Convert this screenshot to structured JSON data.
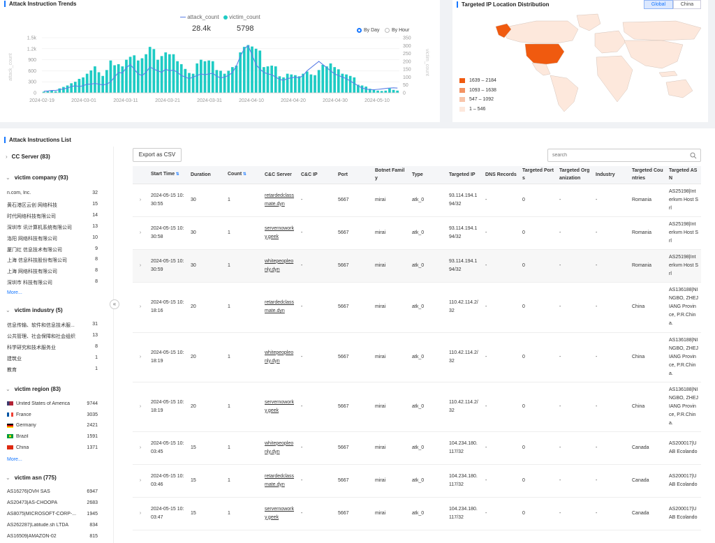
{
  "trends": {
    "title": "Attack Instruction Trends",
    "legend": [
      {
        "name": "attack_count",
        "total": "28.4k",
        "color": "#5b7fe6"
      },
      {
        "name": "victim_count",
        "total": "5798",
        "color": "#1ecbc4"
      }
    ],
    "radio": [
      {
        "label": "By Day",
        "checked": true
      },
      {
        "label": "By Hour",
        "checked": false
      }
    ],
    "y_left_axis_label": "attack_count",
    "y_right_axis_label": "victim_count"
  },
  "chart_data": {
    "type": "bar",
    "x_ticks": [
      "2024-02-19",
      "2024-03-01",
      "2024-03-11",
      "2024-03-21",
      "2024-03-31",
      "2024-04-10",
      "2024-04-20",
      "2024-04-30",
      "2024-05-10"
    ],
    "y_left_ticks": [
      "0",
      "300",
      "600",
      "900",
      "1.2k",
      "1.5k"
    ],
    "y_right_ticks": [
      "0",
      "50",
      "100",
      "150",
      "200",
      "250",
      "300",
      "350"
    ],
    "ylim_left": [
      0,
      1500
    ],
    "ylim_right": [
      0,
      350
    ],
    "series": [
      {
        "name": "attack_count",
        "type": "bar",
        "color": "#1ecbc4",
        "values": [
          30,
          40,
          60,
          40,
          120,
          160,
          200,
          260,
          300,
          380,
          420,
          520,
          610,
          720,
          560,
          460,
          620,
          880,
          750,
          780,
          720,
          900,
          980,
          1020,
          880,
          940,
          1050,
          1250,
          1190,
          900,
          1000,
          1100,
          1050,
          1050,
          860,
          780,
          650,
          540,
          520,
          800,
          900,
          860,
          880,
          860,
          620,
          600,
          520,
          600,
          700,
          740,
          1100,
          1250,
          1300,
          1260,
          1200,
          1150,
          700,
          720,
          740,
          720,
          450,
          420,
          520,
          500,
          480,
          450,
          520,
          580,
          500,
          480,
          620,
          760,
          720,
          800,
          700,
          640,
          520,
          500,
          460,
          420,
          220,
          200,
          170,
          110,
          80,
          60,
          50,
          60,
          120,
          80,
          60
        ]
      },
      {
        "name": "victim_count",
        "type": "line",
        "color": "#5b7fe6",
        "values": [
          10,
          12,
          15,
          15,
          20,
          25,
          30,
          40,
          45,
          40,
          45,
          55,
          55,
          60,
          55,
          50,
          55,
          70,
          100,
          130,
          125,
          160,
          180,
          150,
          120,
          110,
          130,
          165,
          150,
          140,
          130,
          150,
          140,
          145,
          130,
          110,
          100,
          90,
          100,
          110,
          120,
          115,
          120,
          125,
          105,
          95,
          100,
          110,
          130,
          170,
          230,
          280,
          300,
          240,
          180,
          150,
          130,
          120,
          115,
          100,
          85,
          80,
          90,
          95,
          100,
          95,
          110,
          140,
          160,
          180,
          200,
          180,
          160,
          140,
          120,
          110,
          100,
          90,
          75,
          60,
          45,
          30,
          25,
          20,
          20,
          22,
          25,
          28,
          30,
          32,
          30
        ]
      }
    ]
  },
  "geo": {
    "title": "Targeted IP Location Distribution",
    "tabs": [
      {
        "label": "Global",
        "active": true
      },
      {
        "label": "China",
        "active": false
      }
    ],
    "legend": [
      {
        "range": "1639 – 2184",
        "color": "#f05a0f"
      },
      {
        "range": "1093 – 1638",
        "color": "#f39363"
      },
      {
        "range": "547 – 1092",
        "color": "#f8c5aa"
      },
      {
        "range": "1 – 546",
        "color": "#fde8dc"
      }
    ]
  },
  "list": {
    "title": "Attack Instructions List",
    "export_label": "Export as CSV",
    "search_placeholder": "search",
    "more_label": "More...",
    "groups": {
      "cc": {
        "title": "CC Server (83)"
      },
      "company": {
        "title": "victim company (93)",
        "items": [
          {
            "label": "n.com, Inc.",
            "count": "32"
          },
          {
            "label": "黄石港区云创 网络科技",
            "count": "15"
          },
          {
            "label": "时代网络科技有限公司",
            "count": "14"
          },
          {
            "label": "深圳市 讯计算机系统有限公司",
            "count": "13"
          },
          {
            "label": "洛阳 网络科技有限公司",
            "count": "10"
          },
          {
            "label": "厦门红 信息技术有限公司",
            "count": "9"
          },
          {
            "label": "上海 信息科技股份有限公司",
            "count": "8"
          },
          {
            "label": "上海 网络科技有限公司",
            "count": "8"
          },
          {
            "label": "深圳市 科技有限公司",
            "count": "8"
          }
        ]
      },
      "industry": {
        "title": "victim industry (5)",
        "items": [
          {
            "label": "信息传输、软件和信息技术服...",
            "count": "31"
          },
          {
            "label": "公共管理、社会保障和社会组织",
            "count": "13"
          },
          {
            "label": "科学研究和技术服务业",
            "count": "8"
          },
          {
            "label": "建筑业",
            "count": "1"
          },
          {
            "label": "教育",
            "count": "1"
          }
        ]
      },
      "region": {
        "title": "victim region (83)",
        "items": [
          {
            "label": "United States of America",
            "count": "9744",
            "flag": "us"
          },
          {
            "label": "France",
            "count": "3035",
            "flag": "fr"
          },
          {
            "label": "Germany",
            "count": "2421",
            "flag": "de"
          },
          {
            "label": "Brazil",
            "count": "1591",
            "flag": "br"
          },
          {
            "label": "China",
            "count": "1371",
            "flag": "cn"
          }
        ]
      },
      "asn": {
        "title": "victim asn (775)",
        "items": [
          {
            "label": "AS16276|OVH SAS",
            "count": "6947"
          },
          {
            "label": "AS20473|AS-CHOOPA",
            "count": "2683"
          },
          {
            "label": "AS8075|MICROSOFT-CORP-...",
            "count": "1945"
          },
          {
            "label": "AS262287|Latitude.sh LTDA",
            "count": "834"
          },
          {
            "label": "AS16509|AMAZON-02",
            "count": "815"
          }
        ]
      }
    },
    "columns": [
      "",
      "Start Time",
      "Duration",
      "Count",
      "C&C Server",
      "C&C IP",
      "Port",
      "Botnet Family",
      "Type",
      "Targeted IP",
      "DNS Records",
      "Targeted Ports",
      "Targeted Organization",
      "Industry",
      "Targeted Countries",
      "Targeted ASN"
    ],
    "rows": [
      {
        "start": "2024-05-15 10:30:55",
        "duration": "30",
        "count": "1",
        "cc": "retardedclassmate.dyn",
        "ccip": "-",
        "port": "5667",
        "family": "mirai",
        "type": "atk_0",
        "tip": "93.114.194.194/32",
        "dns": "-",
        "tports": "0",
        "org": "-",
        "industry": "-",
        "country": "Romania",
        "asn": "AS25198|Interkvm Host Srl"
      },
      {
        "start": "2024-05-15 10:30:58",
        "duration": "30",
        "count": "1",
        "cc": "servernoworky.geek",
        "ccip": "-",
        "port": "5667",
        "family": "mirai",
        "type": "atk_0",
        "tip": "93.114.194.194/32",
        "dns": "-",
        "tports": "0",
        "org": "-",
        "industry": "-",
        "country": "Romania",
        "asn": "AS25198|Interkvm Host Srl"
      },
      {
        "start": "2024-05-15 10:30:59",
        "duration": "30",
        "count": "1",
        "cc": "whitepeopleonly.dyn",
        "ccip": "-",
        "port": "5667",
        "family": "mirai",
        "type": "atk_0",
        "tip": "93.114.194.194/32",
        "dns": "-",
        "tports": "0",
        "org": "-",
        "industry": "-",
        "country": "Romania",
        "asn": "AS25198|Interkvm Host Srl"
      },
      {
        "start": "2024-05-15 10:18:16",
        "duration": "20",
        "count": "1",
        "cc": "retardedclassmate.dyn",
        "ccip": "-",
        "port": "5667",
        "family": "mirai",
        "type": "atk_0",
        "tip": "110.42.114.2/32",
        "dns": "-",
        "tports": "0",
        "org": "-",
        "industry": "-",
        "country": "China",
        "asn": "AS136188|NINGBO, ZHEJIANG Province, P.R.China."
      },
      {
        "start": "2024-05-15 10:18:19",
        "duration": "20",
        "count": "1",
        "cc": "whitepeopleonly.dyn",
        "ccip": "-",
        "port": "5667",
        "family": "mirai",
        "type": "atk_0",
        "tip": "110.42.114.2/32",
        "dns": "-",
        "tports": "0",
        "org": "-",
        "industry": "-",
        "country": "China",
        "asn": "AS136188|NINGBO, ZHEJIANG Province, P.R.China."
      },
      {
        "start": "2024-05-15 10:18:19",
        "duration": "20",
        "count": "1",
        "cc": "servernoworky.geek",
        "ccip": "-",
        "port": "5667",
        "family": "mirai",
        "type": "atk_0",
        "tip": "110.42.114.2/32",
        "dns": "-",
        "tports": "0",
        "org": "-",
        "industry": "-",
        "country": "China",
        "asn": "AS136188|NINGBO, ZHEJIANG Province, P.R.China."
      },
      {
        "start": "2024-05-15 10:03:45",
        "duration": "15",
        "count": "1",
        "cc": "whitepeopleonly.dyn",
        "ccip": "-",
        "port": "5667",
        "family": "mirai",
        "type": "atk_0",
        "tip": "104.234.180.117/32",
        "dns": "-",
        "tports": "0",
        "org": "-",
        "industry": "-",
        "country": "Canada",
        "asn": "AS200017|UAB Ecolando"
      },
      {
        "start": "2024-05-15 10:03:46",
        "duration": "15",
        "count": "1",
        "cc": "retardedclassmate.dyn",
        "ccip": "-",
        "port": "5667",
        "family": "mirai",
        "type": "atk_0",
        "tip": "104.234.180.117/32",
        "dns": "-",
        "tports": "0",
        "org": "-",
        "industry": "-",
        "country": "Canada",
        "asn": "AS200017|UAB Ecolando"
      },
      {
        "start": "2024-05-15 10:03:47",
        "duration": "15",
        "count": "1",
        "cc": "servernoworky.geek",
        "ccip": "-",
        "port": "5667",
        "family": "mirai",
        "type": "atk_0",
        "tip": "104.234.180.117/32",
        "dns": "-",
        "tports": "0",
        "org": "-",
        "industry": "-",
        "country": "Canada",
        "asn": "AS200017|UAB Ecolando"
      }
    ]
  }
}
